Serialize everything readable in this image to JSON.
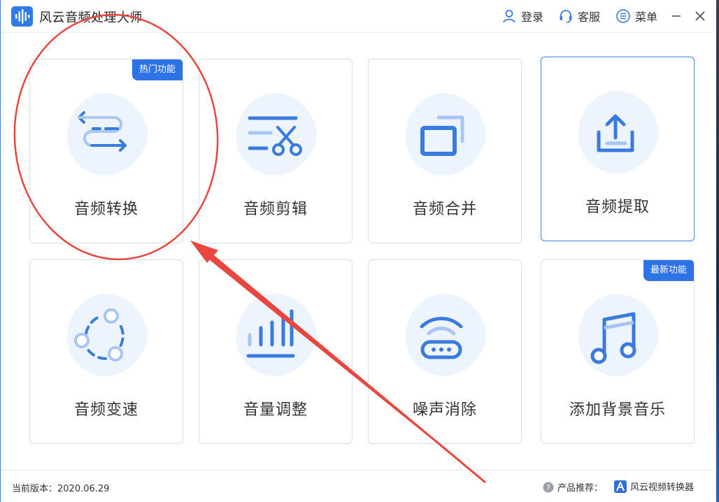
{
  "app": {
    "title": "风云音频处理大师",
    "icon": "audio-wave-logo-icon",
    "accent_color": "#2f7be7"
  },
  "header": {
    "login_label": "登录",
    "support_label": "客服",
    "menu_label": "菜单"
  },
  "features": [
    {
      "label": "音频转换",
      "icon": "convert-arrows-icon",
      "badge": "热门功能"
    },
    {
      "label": "音频剪辑",
      "icon": "scissors-cut-icon",
      "badge": ""
    },
    {
      "label": "音频合并",
      "icon": "merge-windows-icon",
      "badge": ""
    },
    {
      "label": "音频提取",
      "icon": "upload-extract-icon",
      "badge": ""
    },
    {
      "label": "音频变速",
      "icon": "speed-circle-icon",
      "badge": ""
    },
    {
      "label": "音量调整",
      "icon": "volume-bars-icon",
      "badge": ""
    },
    {
      "label": "噪声消除",
      "icon": "noise-wifi-icon",
      "badge": ""
    },
    {
      "label": "添加背景音乐",
      "icon": "music-note-icon",
      "badge": "最新功能"
    }
  ],
  "footer": {
    "version": "当前版本：2020.06.29",
    "recommend_label": "产品推荐：",
    "recommend_product": "风云视频转换器"
  },
  "colors": {
    "icon_blue": "#3a7be0",
    "icon_light": "#a7c6f4",
    "blob": "#eef4fd",
    "annotation_red": "#e8473f"
  }
}
